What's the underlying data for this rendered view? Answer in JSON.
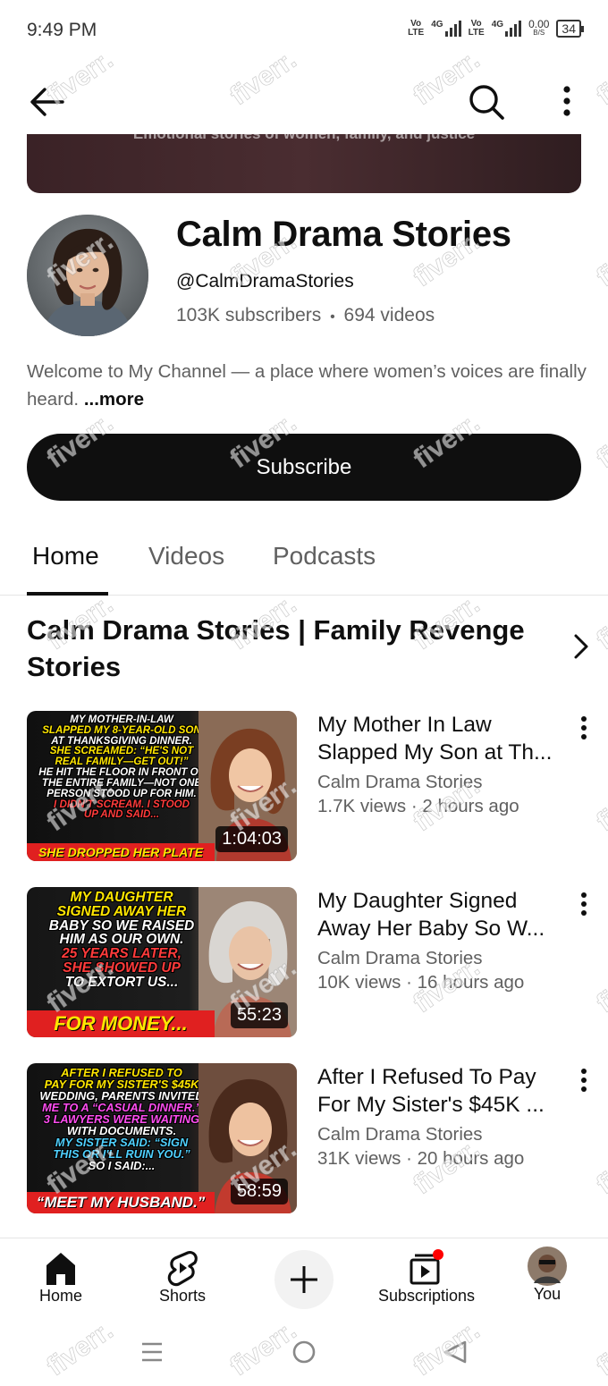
{
  "status": {
    "time": "9:49 PM",
    "net1_label": "Vo\nLTE",
    "net1_gen": "4G",
    "net2_label": "Vo\nLTE",
    "net2_gen": "4G",
    "speed_value": "0.00",
    "speed_unit": "B/S",
    "battery": "34"
  },
  "banner": {
    "text": "Emotional stories of women, family, and justice"
  },
  "channel": {
    "name": "Calm Drama Stories",
    "handle": "@CalmDramaStories",
    "subscribers": "103K subscribers",
    "separator": "•",
    "videos": "694 videos",
    "description": "Welcome to My Channel — a place where women’s voices are finally heard. ",
    "more": "...more",
    "subscribe_label": "Subscribe"
  },
  "tabs": [
    {
      "label": "Home",
      "active": true
    },
    {
      "label": "Videos",
      "active": false
    },
    {
      "label": "Podcasts",
      "active": false
    }
  ],
  "section": {
    "title": "Calm Drama Stories | Family Revenge Stories"
  },
  "videos": [
    {
      "title": "My Mother In Law Slapped My Son at Th...",
      "channel": "Calm Drama Stories",
      "meta": "1.7K views · 2 hours ago",
      "duration": "1:04:03",
      "thumb_lines": [
        {
          "text": "MY MOTHER-IN-LAW",
          "color": "#ffffff"
        },
        {
          "text": "SLAPPED MY 8-YEAR-OLD SON",
          "color": "#ffe600"
        },
        {
          "text": "AT THANKSGIVING DINNER.",
          "color": "#ffffff"
        },
        {
          "text": "SHE SCREAMED: “HE'S NOT",
          "color": "#ffe600"
        },
        {
          "text": "REAL FAMILY—GET OUT!”",
          "color": "#ffe600"
        },
        {
          "text": "HE HIT THE FLOOR IN FRONT OF",
          "color": "#ffffff"
        },
        {
          "text": "THE ENTIRE FAMILY—NOT ONE",
          "color": "#ffffff"
        },
        {
          "text": "PERSON STOOD UP FOR HIM.",
          "color": "#ffffff"
        },
        {
          "text": "I DIDN'T SCREAM. I STOOD",
          "color": "#ff3b3b"
        },
        {
          "text": "UP AND SAID...",
          "color": "#ff3b3b"
        }
      ],
      "thumb_bottom": "SHE DROPPED HER PLATE",
      "thumb_bottom_color": "#ffe600",
      "thumb_bottom_bg": "#e02020"
    },
    {
      "title": "My Daughter Signed Away Her Baby So W...",
      "channel": "Calm Drama Stories",
      "meta": "10K views · 16 hours ago",
      "duration": "55:23",
      "thumb_lines": [
        {
          "text": "MY DAUGHTER",
          "color": "#ffe600"
        },
        {
          "text": "SIGNED AWAY HER",
          "color": "#ffe600"
        },
        {
          "text": "BABY SO WE RAISED",
          "color": "#ffffff"
        },
        {
          "text": "HIM AS OUR OWN.",
          "color": "#ffffff"
        },
        {
          "text": "25 YEARS LATER,",
          "color": "#ff3b3b"
        },
        {
          "text": "SHE SHOWED UP",
          "color": "#ff3b3b"
        },
        {
          "text": "TO EXTORT US...",
          "color": "#ffffff"
        }
      ],
      "thumb_bottom": "FOR MONEY...",
      "thumb_bottom_color": "#ffe600",
      "thumb_bottom_bg": "#e02020"
    },
    {
      "title": "After I Refused To Pay For My Sister's $45K ...",
      "channel": "Calm Drama Stories",
      "meta": "31K views · 20 hours ago",
      "duration": "58:59",
      "thumb_lines": [
        {
          "text": "AFTER I REFUSED TO",
          "color": "#ffe600"
        },
        {
          "text": "PAY FOR MY SISTER'S $45K",
          "color": "#ffe600"
        },
        {
          "text": "WEDDING, PARENTS INVITED",
          "color": "#ffffff"
        },
        {
          "text": "ME TO A “CASUAL DINNER.”",
          "color": "#ff4df0"
        },
        {
          "text": "3 LAWYERS WERE WAITING",
          "color": "#ff4df0"
        },
        {
          "text": "WITH DOCUMENTS.",
          "color": "#ffffff"
        },
        {
          "text": "MY SISTER SAID: “SIGN",
          "color": "#4fd1ff"
        },
        {
          "text": "THIS OR I'LL RUIN YOU.”",
          "color": "#4fd1ff"
        },
        {
          "text": "SO I SAID:...",
          "color": "#ffffff"
        }
      ],
      "thumb_bottom": "“MEET MY HUSBAND.”",
      "thumb_bottom_color": "#ffffff",
      "thumb_bottom_bg": "#e02020"
    }
  ],
  "bottom_nav": {
    "home": "Home",
    "shorts": "Shorts",
    "subscriptions": "Subscriptions",
    "you": "You"
  },
  "watermark": "fiverr.",
  "colors": {
    "text_primary": "#0f0f0f",
    "text_secondary": "#606060",
    "subscribe_bg": "#0f0f0f",
    "notification_dot": "#ff0000"
  }
}
